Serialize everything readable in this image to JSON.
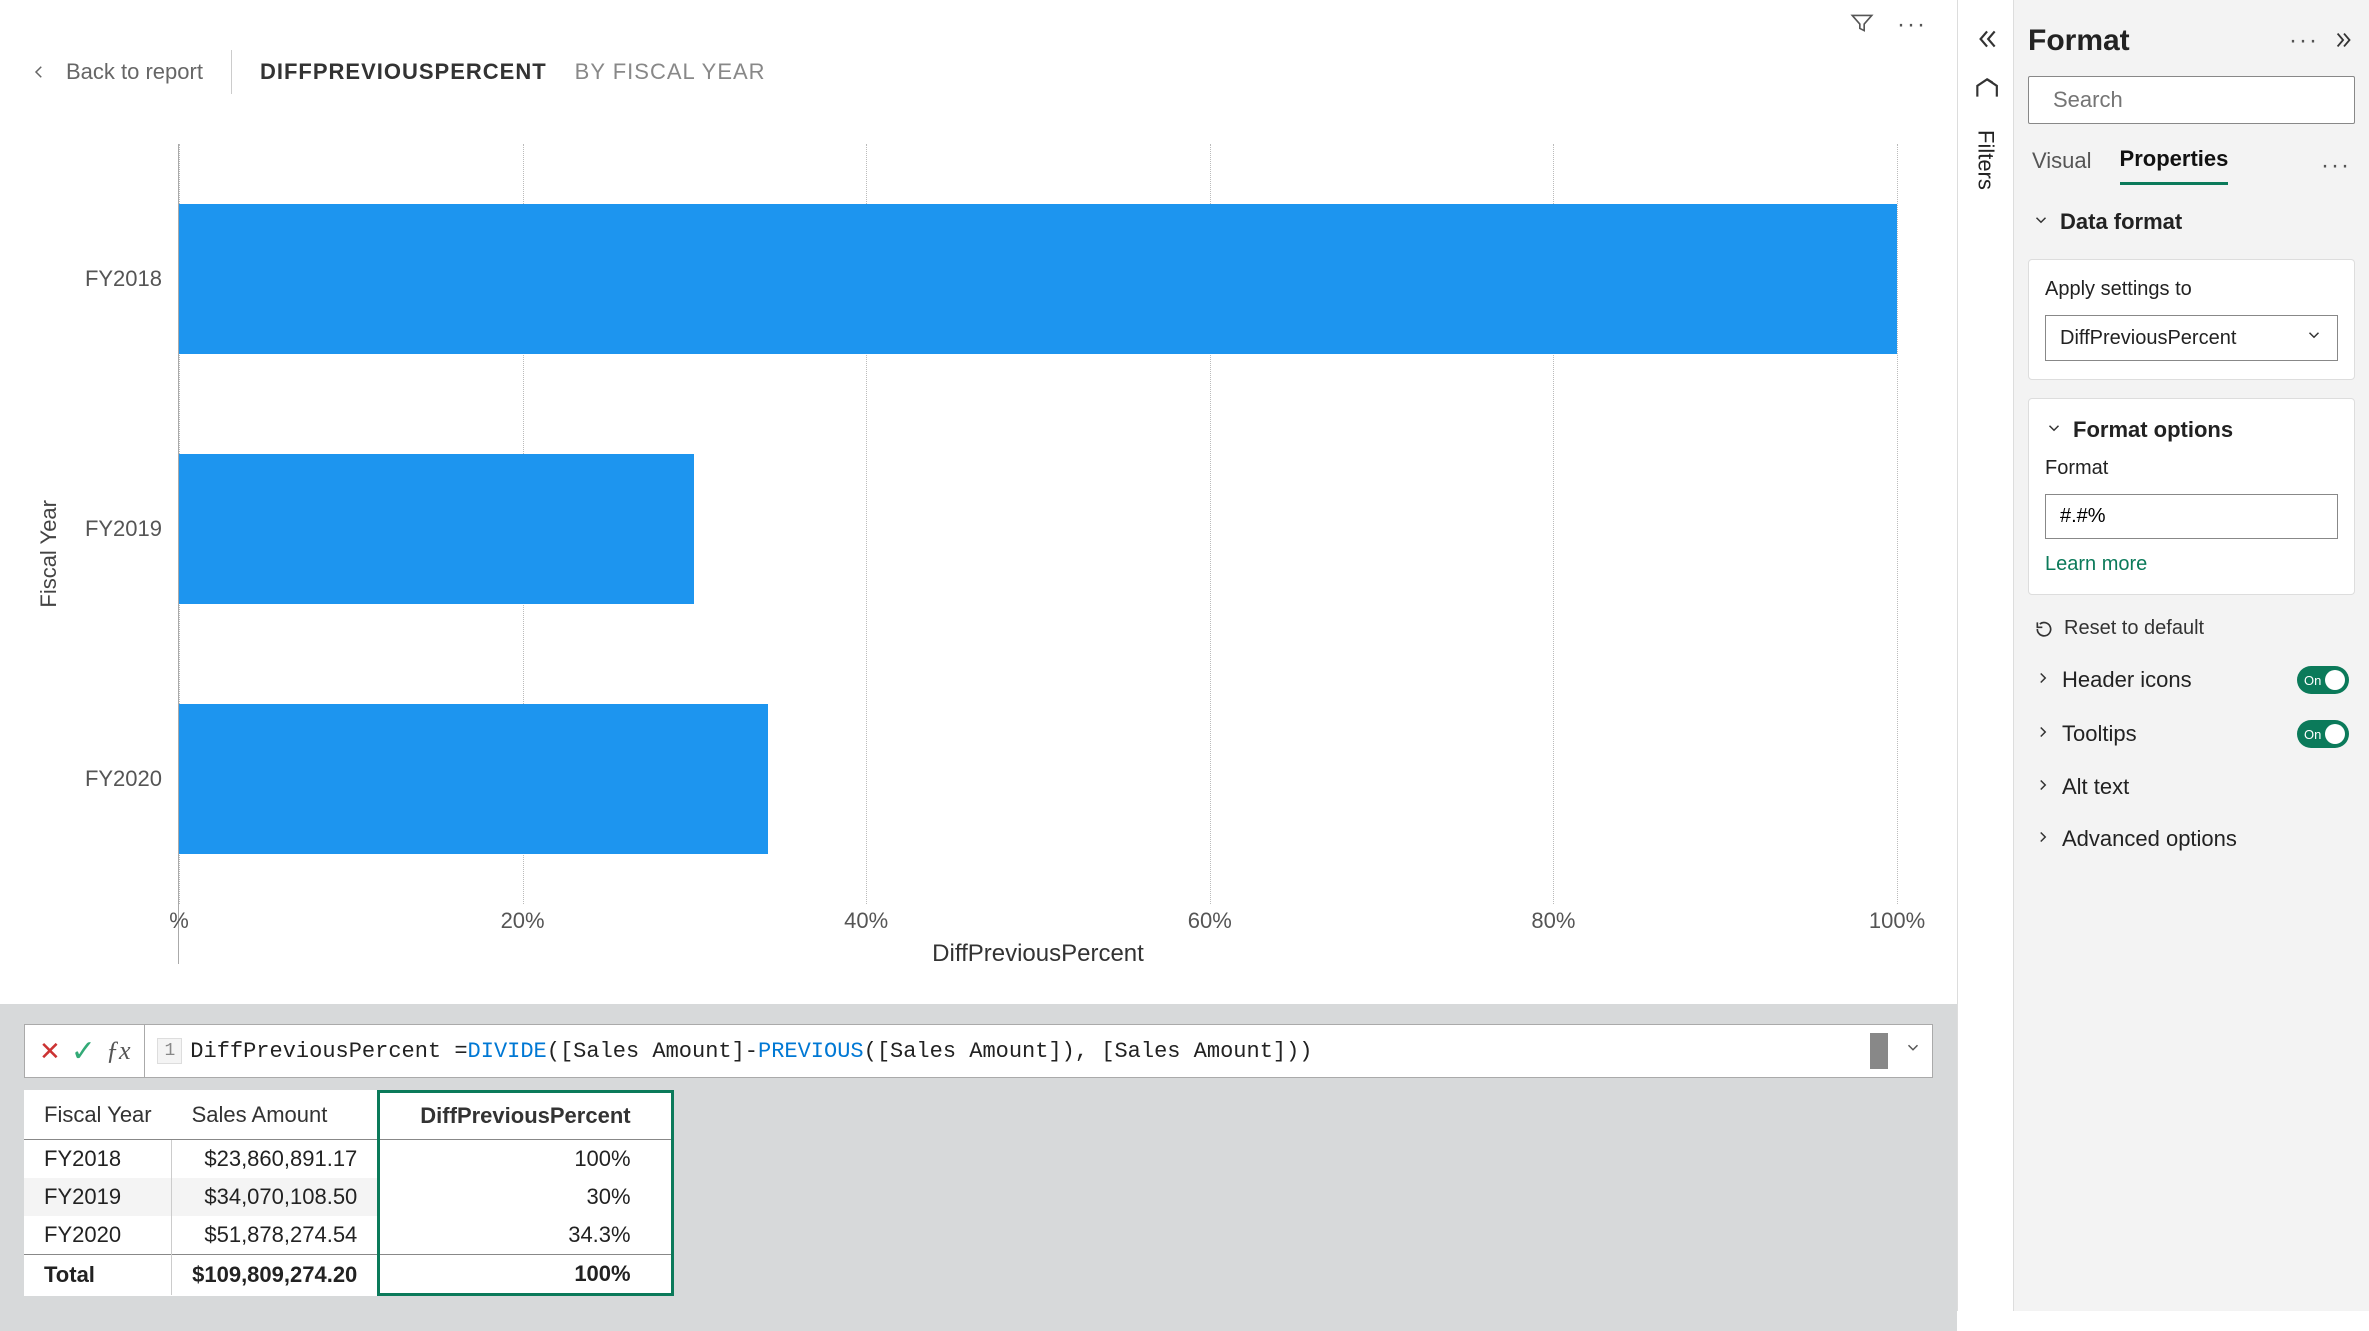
{
  "chart_data": {
    "type": "bar",
    "orientation": "horizontal",
    "categories": [
      "FY2018",
      "FY2019",
      "FY2020"
    ],
    "values": [
      100,
      30,
      34.3
    ],
    "title": "",
    "xlabel": "DiffPreviousPercent",
    "ylabel": "Fiscal Year",
    "xlim": [
      0,
      100
    ],
    "x_ticks": [
      "%",
      "20%",
      "40%",
      "60%",
      "80%",
      "100%"
    ]
  },
  "breadcrumb": {
    "back": "Back to report",
    "measure": "DIFFPREVIOUSPERCENT",
    "context": "BY FISCAL YEAR"
  },
  "formula": {
    "line": "1",
    "prefix": "DiffPreviousPercent = ",
    "fnDivide": "DIVIDE",
    "seg1": "([Sales Amount]-",
    "fnPrev": "PREVIOUS",
    "seg2": "([Sales Amount]), [Sales Amount]))"
  },
  "table": {
    "headers": [
      "Fiscal Year",
      "Sales Amount",
      "DiffPreviousPercent"
    ],
    "rows": [
      {
        "fy": "FY2018",
        "amt": "$23,860,891.17",
        "pct": "100%"
      },
      {
        "fy": "FY2019",
        "amt": "$34,070,108.50",
        "pct": "30%"
      },
      {
        "fy": "FY2020",
        "amt": "$51,878,274.54",
        "pct": "34.3%"
      }
    ],
    "total": {
      "fy": "Total",
      "amt": "$109,809,274.20",
      "pct": "100%"
    }
  },
  "filters_tab": "Filters",
  "format_panel": {
    "title": "Format",
    "search_placeholder": "Search",
    "tabs": {
      "visual": "Visual",
      "properties": "Properties"
    },
    "data_format": "Data format",
    "apply_settings": "Apply settings to",
    "apply_value": "DiffPreviousPercent",
    "format_options": "Format options",
    "format_label": "Format",
    "format_value": "#.#%",
    "learn_more": "Learn more",
    "reset": "Reset to default",
    "header_icons": "Header icons",
    "tooltips": "Tooltips",
    "alt_text": "Alt text",
    "advanced": "Advanced options",
    "on": "On"
  }
}
